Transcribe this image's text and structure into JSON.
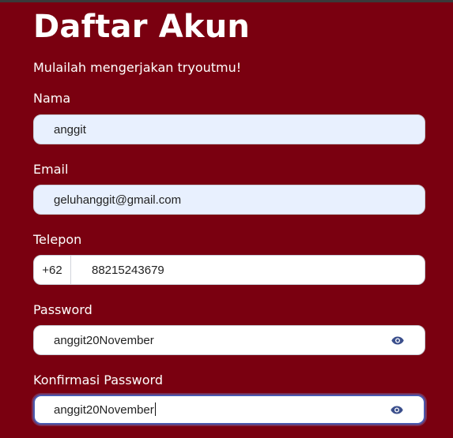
{
  "form": {
    "title": "Daftar Akun",
    "subtitle": "Mulailah mengerjakan tryoutmu!",
    "name": {
      "label": "Nama",
      "value": "anggit"
    },
    "email": {
      "label": "Email",
      "value": "geluhanggit@gmail.com"
    },
    "phone": {
      "label": "Telepon",
      "prefix": "+62",
      "value": "88215243679"
    },
    "password": {
      "label": "Password",
      "value": "anggit20November",
      "toggle_icon": "eye-icon"
    },
    "confirm_password": {
      "label": "Konfirmasi Password",
      "value": "anggit20November",
      "toggle_icon": "eye-icon"
    }
  },
  "colors": {
    "background": "#7a0010",
    "autofill": "#e8f0fe",
    "focus_ring": "#4a5ab0",
    "icon": "#3b4f8c"
  }
}
